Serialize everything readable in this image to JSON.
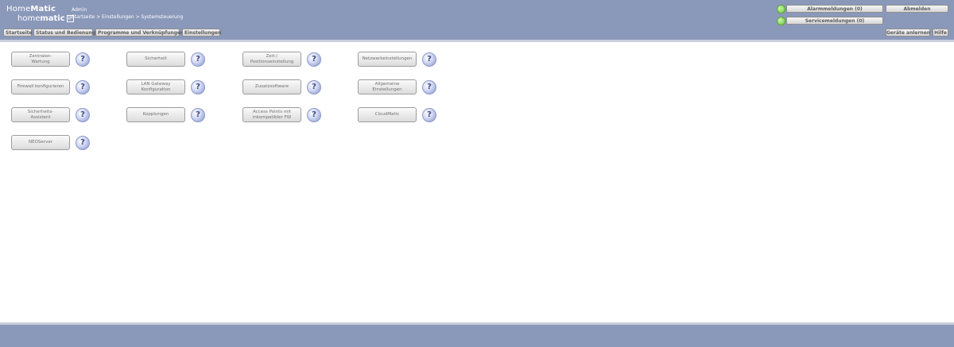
{
  "header": {
    "logo": {
      "top_part1": "Home",
      "top_part2": "Matic",
      "bottom_part1": "home",
      "bottom_part2": "matic",
      "box": "IP"
    },
    "user": "Admin",
    "breadcrumb": "Startseite > Einstellungen > Systemsteuerung",
    "alarm_label": "Alarmmeldungen (0)",
    "service_label": "Servicemeldungen (0)",
    "logout_label": "Abmelden",
    "teach_label": "Geräte anlernen",
    "help_label": "Hilfe",
    "led_color": "#6ccc3c"
  },
  "nav": [
    {
      "label": "Startseite"
    },
    {
      "label": "Status und Bedienung"
    },
    {
      "label": "Programme und Verknüpfungen"
    },
    {
      "label": "Einstellungen"
    }
  ],
  "tiles": [
    {
      "line1": "Zentralen-",
      "line2": "Wartung"
    },
    {
      "line1": "Sicherheit",
      "line2": ""
    },
    {
      "line1": "Zeit-/",
      "line2": "Positionseinstellung"
    },
    {
      "line1": "Netzwerkeinstellungen",
      "line2": ""
    },
    {
      "line1": "Firewall konfigurieren",
      "line2": ""
    },
    {
      "line1": "LAN Gateway",
      "line2": "Konfiguration"
    },
    {
      "line1": "Zusatzsoftware",
      "line2": ""
    },
    {
      "line1": "Allgemeine",
      "line2": "Einstellungen"
    },
    {
      "line1": "Sicherheits-",
      "line2": "Assistent"
    },
    {
      "line1": "Kopplungen",
      "line2": ""
    },
    {
      "line1": "Access Points mit",
      "line2": "inkompatibler FW"
    },
    {
      "line1": "CloudMatic",
      "line2": ""
    },
    {
      "line1": "NEOServer",
      "line2": ""
    }
  ],
  "help_glyph": "?",
  "colors": {
    "header_bg": "#8a98ba",
    "content_bg": "#ffffff"
  }
}
